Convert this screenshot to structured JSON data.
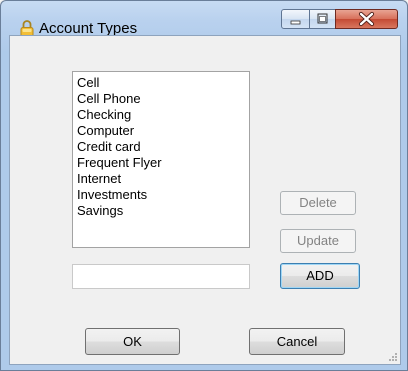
{
  "window": {
    "title": "Account Types"
  },
  "list": {
    "items": [
      "Cell",
      "Cell Phone",
      "Checking",
      "Computer",
      "Credit card",
      "Frequent Flyer",
      "Internet",
      "Investments",
      "Savings"
    ]
  },
  "input": {
    "value": ""
  },
  "buttons": {
    "delete": "Delete",
    "update": "Update",
    "add": "ADD",
    "ok": "OK",
    "cancel": "Cancel"
  },
  "colors": {
    "titlebar": "#b9d1ee",
    "close": "#c44a34",
    "client": "#f0f0f0"
  }
}
